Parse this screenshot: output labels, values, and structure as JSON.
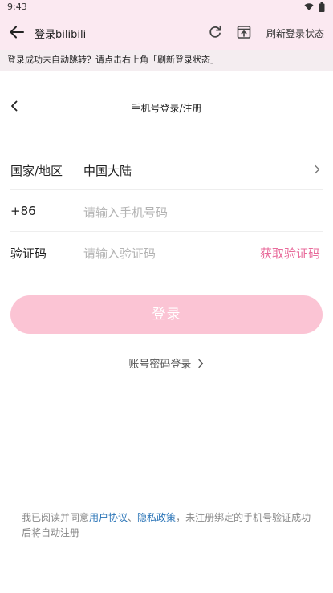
{
  "status_bar": {
    "time": "9:43"
  },
  "app_bar": {
    "title": "登录bilibili",
    "refresh_label": "刷新登录状态"
  },
  "notice": {
    "text": "登录成功未自动跳转？请点击右上角「刷新登录状态」"
  },
  "page": {
    "title": "手机号登录/注册"
  },
  "form": {
    "region_label": "国家/地区",
    "region_value": "中国大陆",
    "phone_prefix": "+86",
    "phone_placeholder": "请输入手机号码",
    "code_label": "验证码",
    "code_placeholder": "请输入验证码",
    "get_code": "获取验证码"
  },
  "login_button": "登录",
  "password_login": "账号密码登录",
  "agreement": {
    "prefix": "我已阅读并同意",
    "user_agreement": "用户协议",
    "sep": "、",
    "privacy_policy": "隐私政策",
    "suffix": "，未注册绑定的手机号验证成功后将自动注册"
  },
  "colors": {
    "header_bg": "#fbe9f1",
    "accent": "#e86b9b",
    "button_bg": "#fbc4d4",
    "link": "#2a74b7"
  }
}
